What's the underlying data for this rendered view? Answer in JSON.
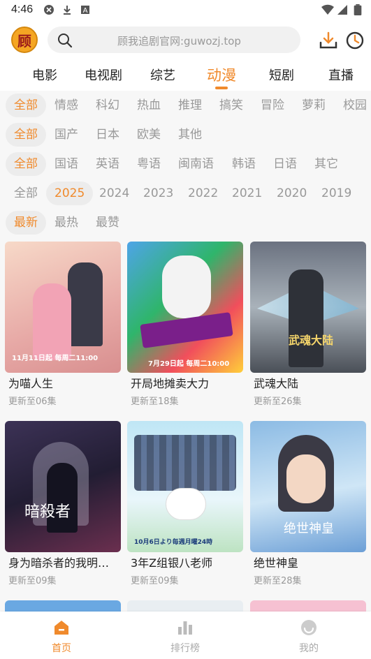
{
  "status": {
    "time": "4:46"
  },
  "header": {
    "logo_text": "顾",
    "search_placeholder": "顾我追剧官网:guwozj.top"
  },
  "nav_tabs": [
    "电影",
    "电视剧",
    "综艺",
    "动漫",
    "短剧",
    "直播"
  ],
  "active_tab": "动漫",
  "filters": {
    "genre": [
      "全部",
      "情感",
      "科幻",
      "热血",
      "推理",
      "搞笑",
      "冒险",
      "萝莉",
      "校园"
    ],
    "region": [
      "全部",
      "国产",
      "日本",
      "欧美",
      "其他"
    ],
    "language": [
      "全部",
      "国语",
      "英语",
      "粤语",
      "闽南语",
      "韩语",
      "日语",
      "其它"
    ],
    "year": [
      "全部",
      "2025",
      "2024",
      "2023",
      "2022",
      "2021",
      "2020",
      "2019"
    ],
    "sort": [
      "最新",
      "最热",
      "最赞"
    ]
  },
  "cards": [
    {
      "title": "为喵人生",
      "sub": "更新至06集",
      "poster_text": "11月11日起 每周二11:00",
      "color1": "#f3c9b8",
      "color2": "#e6a4a0"
    },
    {
      "title": "开局地摊卖大力",
      "sub": "更新至18集",
      "poster_text": "7月29日起 每周二10:00",
      "color1": "#e8353b",
      "color2": "#3b7ee0"
    },
    {
      "title": "武魂大陆",
      "sub": "更新至26集",
      "poster_text": "武魂大陆",
      "color1": "#4a5160",
      "color2": "#9aa3ad"
    },
    {
      "title": "身为暗杀者的我明显比勇者还强",
      "sub": "更新至09集",
      "poster_text": "暗殺者",
      "color1": "#2b2540",
      "color2": "#7b3a5a"
    },
    {
      "title": "3年Z组银八老师",
      "sub": "更新至09集",
      "poster_text": "10月6日より毎週月曜24時",
      "color1": "#9ad0ea",
      "color2": "#eaf4fa"
    },
    {
      "title": "绝世神皇",
      "sub": "更新至28集",
      "poster_text": "绝世神皇",
      "color1": "#6aa3d8",
      "color2": "#c9e3f5"
    }
  ],
  "bottom_nav": [
    {
      "label": "首页",
      "icon": "home-icon"
    },
    {
      "label": "排行榜",
      "icon": "ranking-icon"
    },
    {
      "label": "我的",
      "icon": "profile-icon"
    }
  ],
  "colors": {
    "accent": "#f08a2c",
    "muted": "#999999"
  }
}
